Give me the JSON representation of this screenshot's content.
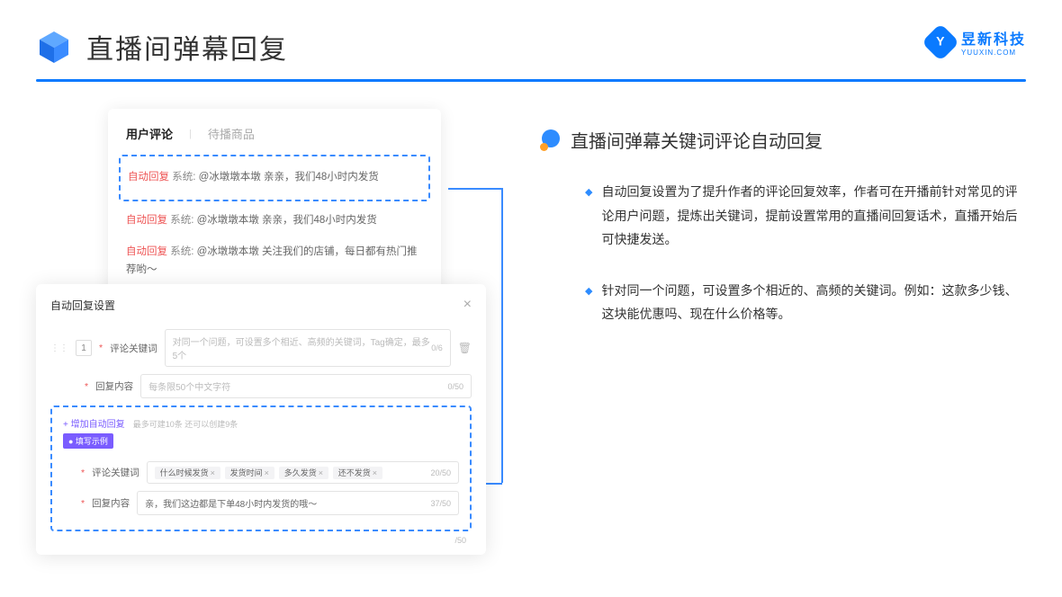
{
  "header": {
    "title": "直播间弹幕回复",
    "brand": "昱新科技",
    "brandSub": "YUUXIN.COM"
  },
  "card1": {
    "tab1": "用户评论",
    "tab2": "待播商品",
    "c1_tag": "自动回复",
    "c1_sys": "系统:",
    "c1_txt": "@冰墩墩本墩 亲亲，我们48小时内发货",
    "c2_tag": "自动回复",
    "c2_sys": "系统:",
    "c2_txt": "@冰墩墩本墩 亲亲，我们48小时内发货",
    "c3_tag": "自动回复",
    "c3_sys": "系统:",
    "c3_txt": "@冰墩墩本墩 关注我们的店铺，每日都有热门推荐哟～"
  },
  "card2": {
    "title": "自动回复设置",
    "num": "1",
    "label1": "评论关键词",
    "ph1": "对同一个问题，可设置多个相近、高频的关键词，Tag确定，最多5个",
    "cnt1": "0/6",
    "label2": "回复内容",
    "ph2": "每条限50个中文字符",
    "cnt2": "0/50",
    "addLink": "+ 增加自动回复",
    "addHint": "最多可建10条 还可以创建9条",
    "exTag": "● 填写示例",
    "exLabel1": "评论关键词",
    "chip1": "什么时候发货",
    "chip2": "发货时间",
    "chip3": "多久发货",
    "chip4": "还不发货",
    "exCnt1": "20/50",
    "exLabel2": "回复内容",
    "exVal2": "亲，我们这边都是下单48小时内发货的哦～",
    "exCnt2": "37/50",
    "bottomCnt": "/50"
  },
  "right": {
    "title": "直播间弹幕关键词评论自动回复",
    "p1": "自动回复设置为了提升作者的评论回复效率，作者可在开播前针对常见的评论用户问题，提炼出关键词，提前设置常用的直播间回复话术，直播开始后可快捷发送。",
    "p2": "针对同一个问题，可设置多个相近的、高频的关键词。例如：这款多少钱、这块能优惠吗、现在什么价格等。"
  }
}
